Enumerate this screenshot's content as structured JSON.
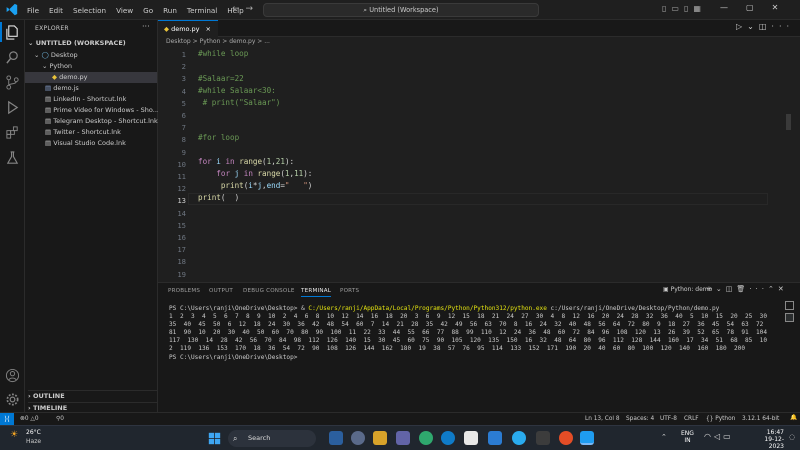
{
  "menu": [
    "File",
    "Edit",
    "Selection",
    "View",
    "Go",
    "Run",
    "Terminal",
    "Help"
  ],
  "command_center": "Untitled (Workspace)",
  "explorer": {
    "title": "EXPLORER",
    "workspace": "UNTITLED (WORKSPACE)",
    "desktop": "Desktop",
    "python_folder": "Python",
    "files": [
      "demo.py",
      "demo.js",
      "LinkedIn - Shortcut.lnk",
      "Prime Video for Windows - Sho...",
      "Telegram Desktop - Shortcut.lnk",
      "Twitter - Shortcut.lnk",
      "Visual Studio Code.lnk"
    ],
    "outline": "OUTLINE",
    "timeline": "TIMELINE"
  },
  "tab": {
    "label": "demo.py",
    "close": "×"
  },
  "breadcrumb": "Desktop > Python > demo.py > ...",
  "line_numbers": [
    "1",
    "2",
    "3",
    "4",
    "5",
    "6",
    "7",
    "8",
    "9",
    "10",
    "11",
    "12",
    "13",
    "14",
    "15",
    "16",
    "17",
    "18",
    "19"
  ],
  "panel": {
    "tabs": [
      "PROBLEMS",
      "OUTPUT",
      "DEBUG CONSOLE",
      "TERMINAL",
      "PORTS"
    ],
    "active_tab": "TERMINAL",
    "terminal_label": "Python: demo",
    "terminal_prompt": "PS C:\\Users\\ranji\\OneDrive\\Desktop> & ",
    "terminal_cmd": "C:/Users/ranji/AppData/Local/Programs/Python/Python312/python.exe",
    "terminal_args": " c:/Users/ranji/OneDrive/Desktop/Python/demo.py",
    "terminal_output": "1  2  3  4  5  6  7  8  9  10  2  4  6  8  10  12  14  16  18  20  3  6  9  12  15  18  21  24  27  30  4  8  12  16  20  24  28  32  36  40  5  10  15  20  25  30  35  40  45  50  6  12  18  24  30  36  42  48  54  60  7  14  21  28  35  42  49  56  63  70  8  16  24  32  40  48  56  64  72  80  9  18  27  36  45  54  63  72  81  90  10  20  30  40  50  60  70  80  90  100  11  22  33  44  55  66  77  88  99  110  12  24  36  48  60  72  84  96  108  120  13  26  39  52  65  78  91  104  117  130  14  28  42  56  70  84  98  112  126  140  15  30  45  60  75  90  105  120  135  150  16  32  48  64  80  96  112  128  144  160  17  34  51  68  85  102  119  136  153  170  18  36  54  72  90  108  126  144  162  180  19  38  57  76  95  114  133  152  171  190  20  40  60  80  100  120  140  160  180  200",
    "terminal_final": "PS C:\\Users\\ranji\\OneDrive\\Desktop>"
  },
  "status": {
    "errors": "0",
    "warnings": "0",
    "ports": "0",
    "position": "Ln 13, Col 8",
    "spaces": "Spaces: 4",
    "encoding": "UTF-8",
    "eol": "CRLF",
    "language": "Python",
    "interpreter": "3.12.1 64-bit"
  },
  "taskbar": {
    "weather_temp": "26°C",
    "weather_desc": "Haze",
    "search_placeholder": "Search",
    "lang": "ENG",
    "region": "IN",
    "time": "16:47",
    "date": "19-12-2023"
  },
  "colors": {
    "accent": "#0078d4",
    "editor_bg": "#1f1f1f",
    "sidebar_bg": "#181818"
  }
}
